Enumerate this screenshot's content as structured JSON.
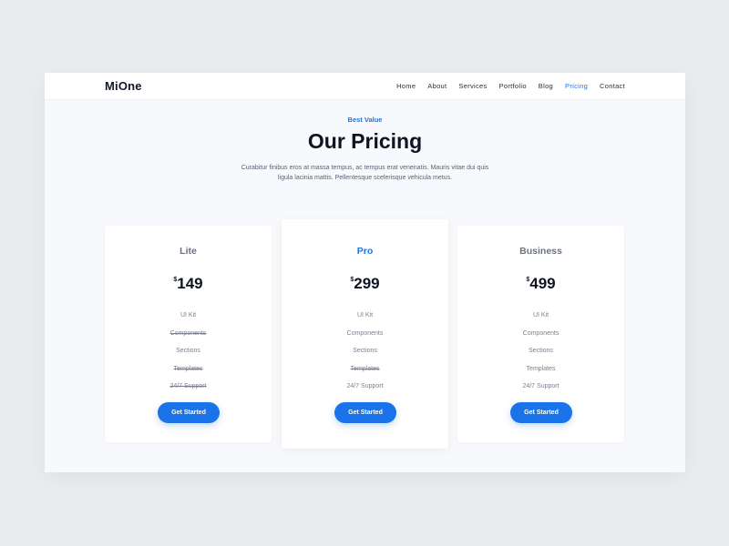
{
  "brand": {
    "logo": "MiOne"
  },
  "nav": {
    "items": [
      {
        "label": "Home",
        "active": false
      },
      {
        "label": "About",
        "active": false
      },
      {
        "label": "Services",
        "active": false
      },
      {
        "label": "Portfolio",
        "active": false
      },
      {
        "label": "Blog",
        "active": false
      },
      {
        "label": "Pricing",
        "active": true
      },
      {
        "label": "Contact",
        "active": false
      }
    ]
  },
  "section": {
    "eyebrow": "Best Value",
    "title": "Our Pricing",
    "description_line1": "Curabitur finibus eros at massa tempus, ac tempus erat venenatis. Mauris vitae dui quis",
    "description_line2": "ligula lacinia mattis. Pellentesque scelerisque vehicula metus."
  },
  "plans": [
    {
      "name": "Lite",
      "currency": "$",
      "price": "149",
      "features": [
        {
          "label": "UI Kit",
          "included": true
        },
        {
          "label": "Components",
          "included": false
        },
        {
          "label": "Sections",
          "included": true
        },
        {
          "label": "Templates",
          "included": false
        },
        {
          "label": "24/7 Support",
          "included": false
        }
      ],
      "cta": "Get Started"
    },
    {
      "name": "Pro",
      "currency": "$",
      "price": "299",
      "features": [
        {
          "label": "UI Kit",
          "included": true
        },
        {
          "label": "Components",
          "included": true
        },
        {
          "label": "Sections",
          "included": true
        },
        {
          "label": "Templates",
          "included": false
        },
        {
          "label": "24/7 Support",
          "included": true
        }
      ],
      "cta": "Get Started"
    },
    {
      "name": "Business",
      "currency": "$",
      "price": "499",
      "features": [
        {
          "label": "UI Kit",
          "included": true
        },
        {
          "label": "Components",
          "included": true
        },
        {
          "label": "Sections",
          "included": true
        },
        {
          "label": "Templates",
          "included": true
        },
        {
          "label": "24/7 Support",
          "included": true
        }
      ],
      "cta": "Get Started"
    }
  ],
  "colors": {
    "accent": "#1a73e8",
    "page_background": "#f7f9fc",
    "card_background": "#ffffff",
    "heading": "#0f1420"
  }
}
